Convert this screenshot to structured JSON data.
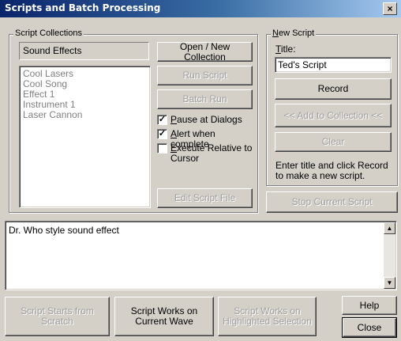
{
  "window": {
    "title": "Scripts and Batch Processing",
    "close_glyph": "×"
  },
  "collections": {
    "legend": "Script Collections",
    "current_name": "Sound Effects",
    "items": [
      "Cool Lasers",
      "Cool Song",
      "Effect 1",
      "Instrument 1",
      "Laser Cannon"
    ],
    "open_new_label": "Open / New Collection",
    "run_script_label": "Run Script",
    "batch_run_label": "Batch Run",
    "edit_script_label": "Edit Script File",
    "pause_at_dialogs": {
      "label_u": "P",
      "label_rest": "ause at Dialogs",
      "checked": true
    },
    "alert_when_complete": {
      "label_u": "A",
      "label_rest": "lert when complete",
      "checked": true
    },
    "execute_relative": {
      "label_u": "E",
      "label_rest": "xecute Relative to",
      "label_line2": "Cursor",
      "checked": false
    },
    "check_glyph": "✓"
  },
  "new_script": {
    "legend_u": "N",
    "legend_rest": "ew Script",
    "title_label_u": "T",
    "title_label_rest": "itle:",
    "title_value": "Ted's Script",
    "record_label": "Record",
    "add_to_collection_label": "<< Add to Collection <<",
    "clear_label": "Clear",
    "hint": "Enter title and click Record to make a new script."
  },
  "stop_current_script_label": "Stop Current Script",
  "description_text": "Dr. Who style sound effect",
  "bottom": {
    "starts_from_scratch_label": "Script Starts from Scratch",
    "works_on_wave_label": "Script Works on Current Wave",
    "works_on_selection_label": "Script Works on Highlighted Selection",
    "help_label": "Help",
    "close_label": "Close"
  },
  "scroll_glyphs": {
    "up": "▲",
    "down": "▼"
  }
}
